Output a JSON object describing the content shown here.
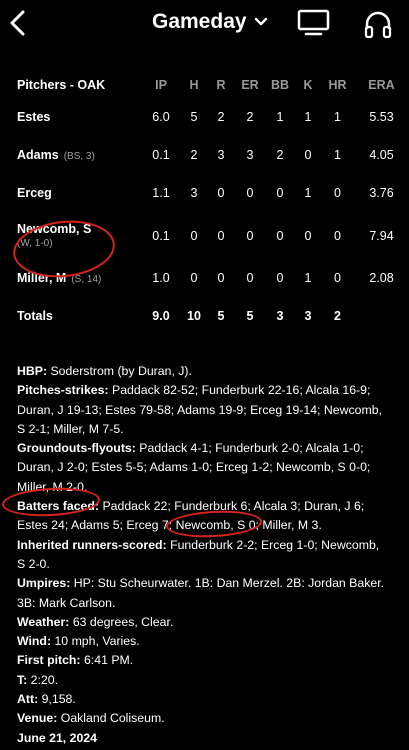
{
  "header": {
    "title": "Gameday",
    "icons": [
      "back-chevron-icon",
      "chevron-down-icon",
      "tv-icon",
      "headphones-icon"
    ]
  },
  "pitchers": {
    "team_label": "Pitchers - OAK",
    "columns": [
      "IP",
      "H",
      "R",
      "ER",
      "BB",
      "K",
      "HR",
      "ERA"
    ],
    "rows": [
      {
        "name": "Estes",
        "note": "",
        "stats": [
          "6.0",
          "5",
          "2",
          "2",
          "1",
          "1",
          "1",
          "5.53"
        ]
      },
      {
        "name": "Adams",
        "note": "(BS, 3)",
        "stats": [
          "0.1",
          "2",
          "3",
          "3",
          "2",
          "0",
          "1",
          "4.05"
        ]
      },
      {
        "name": "Erceg",
        "note": "",
        "stats": [
          "1.1",
          "3",
          "0",
          "0",
          "0",
          "1",
          "0",
          "3.76"
        ]
      },
      {
        "name": "Newcomb, S",
        "note": "(W, 1-0)",
        "stats": [
          "0.1",
          "0",
          "0",
          "0",
          "0",
          "0",
          "0",
          "7.94"
        ]
      },
      {
        "name": "Miller, M",
        "note": "(S, 14)",
        "stats": [
          "1.0",
          "0",
          "0",
          "0",
          "0",
          "1",
          "0",
          "2.08"
        ]
      }
    ],
    "totals": {
      "label": "Totals",
      "stats": [
        "9.0",
        "10",
        "5",
        "5",
        "3",
        "3",
        "2",
        ""
      ]
    }
  },
  "details": [
    {
      "label": "HBP:",
      "text": "Soderstrom (by Duran, J)."
    },
    {
      "label": "Pitches-strikes:",
      "text": "Paddack 82-52; Funderburk 22-16; Alcala 16-9; Duran, J 19-13; Estes 79-58; Adams 19-9; Erceg 19-14; Newcomb, S 2-1; Miller, M 7-5."
    },
    {
      "label": "Groundouts-flyouts:",
      "text": "Paddack 4-1; Funderburk 2-0; Alcala 1-0; Duran, J 2-0; Estes 5-5; Adams 1-0; Erceg 1-2; Newcomb, S 0-0; Miller, M 2-0."
    },
    {
      "label": "Batters faced:",
      "text": "Paddack 22; Funderburk 6; Alcala 3; Duran, J 6; Estes 24; Adams 5; Erceg 7; Newcomb, S 0; Miller, M 3."
    },
    {
      "label": "Inherited runners-scored:",
      "text": "Funderburk 2-2; Erceg 1-0; Newcomb, S 2-0."
    },
    {
      "label": "Umpires:",
      "text": "HP: Stu Scheurwater. 1B: Dan Merzel. 2B: Jordan Baker. 3B: Mark Carlson."
    },
    {
      "label": "Weather:",
      "text": "63 degrees, Clear."
    },
    {
      "label": "Wind:",
      "text": "10 mph, Varies."
    },
    {
      "label": "First pitch:",
      "text": "6:41 PM."
    },
    {
      "label": "T:",
      "text": "2:20."
    },
    {
      "label": "Att:",
      "text": "9,158."
    },
    {
      "label": "Venue:",
      "text": "Oakland Coliseum."
    }
  ],
  "date": "June 21, 2024",
  "colors": {
    "background": "#000000",
    "header_text": "#9a9a9a",
    "annotation": "#d4241b"
  }
}
